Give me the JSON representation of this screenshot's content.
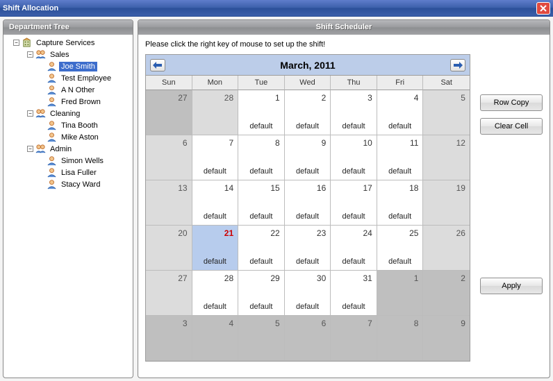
{
  "window": {
    "title": "Shift Allocation"
  },
  "left": {
    "header": "Department Tree",
    "root": "Capture Services",
    "departments": [
      {
        "name": "Sales",
        "employees": [
          "Joe Smith",
          "Test  Employee",
          "A N Other",
          "Fred Brown"
        ],
        "selected": "Joe Smith"
      },
      {
        "name": "Cleaning",
        "employees": [
          "Tina Booth",
          "Mike Aston"
        ]
      },
      {
        "name": "Admin",
        "employees": [
          "Simon Wells",
          "Lisa Fuller",
          "Stacy Ward"
        ]
      }
    ]
  },
  "right": {
    "header": "Shift Scheduler",
    "hint": "Please click the right key of mouse to set up the shift!",
    "monthTitle": "March, 2011",
    "dow": [
      "Sun",
      "Mon",
      "Tue",
      "Wed",
      "Thu",
      "Fri",
      "Sat"
    ],
    "rows": [
      [
        {
          "n": "27",
          "kind": "outside"
        },
        {
          "n": "28",
          "kind": "weekend"
        },
        {
          "n": "1",
          "shift": "default"
        },
        {
          "n": "2",
          "shift": "default"
        },
        {
          "n": "3",
          "shift": "default"
        },
        {
          "n": "4",
          "shift": "default"
        },
        {
          "n": "5",
          "kind": "weekend"
        }
      ],
      [
        {
          "n": "6",
          "kind": "weekend"
        },
        {
          "n": "7",
          "shift": "default"
        },
        {
          "n": "8",
          "shift": "default"
        },
        {
          "n": "9",
          "shift": "default"
        },
        {
          "n": "10",
          "shift": "default"
        },
        {
          "n": "11",
          "shift": "default"
        },
        {
          "n": "12",
          "kind": "weekend"
        }
      ],
      [
        {
          "n": "13",
          "kind": "weekend"
        },
        {
          "n": "14",
          "shift": "default"
        },
        {
          "n": "15",
          "shift": "default"
        },
        {
          "n": "16",
          "shift": "default"
        },
        {
          "n": "17",
          "shift": "default"
        },
        {
          "n": "18",
          "shift": "default"
        },
        {
          "n": "19",
          "kind": "weekend"
        }
      ],
      [
        {
          "n": "20",
          "kind": "weekend"
        },
        {
          "n": "21",
          "shift": "default",
          "kind": "today"
        },
        {
          "n": "22",
          "shift": "default"
        },
        {
          "n": "23",
          "shift": "default"
        },
        {
          "n": "24",
          "shift": "default"
        },
        {
          "n": "25",
          "shift": "default"
        },
        {
          "n": "26",
          "kind": "weekend"
        }
      ],
      [
        {
          "n": "27",
          "kind": "weekend"
        },
        {
          "n": "28",
          "shift": "default"
        },
        {
          "n": "29",
          "shift": "default"
        },
        {
          "n": "30",
          "shift": "default"
        },
        {
          "n": "31",
          "shift": "default"
        },
        {
          "n": "1",
          "kind": "outside"
        },
        {
          "n": "2",
          "kind": "outside"
        }
      ],
      [
        {
          "n": "3",
          "kind": "outside"
        },
        {
          "n": "4",
          "kind": "outside"
        },
        {
          "n": "5",
          "kind": "outside"
        },
        {
          "n": "6",
          "kind": "outside"
        },
        {
          "n": "7",
          "kind": "outside"
        },
        {
          "n": "8",
          "kind": "outside"
        },
        {
          "n": "9",
          "kind": "outside"
        }
      ]
    ],
    "buttons": {
      "rowCopy": "Row Copy",
      "clearCell": "Clear Cell",
      "apply": "Apply"
    }
  }
}
